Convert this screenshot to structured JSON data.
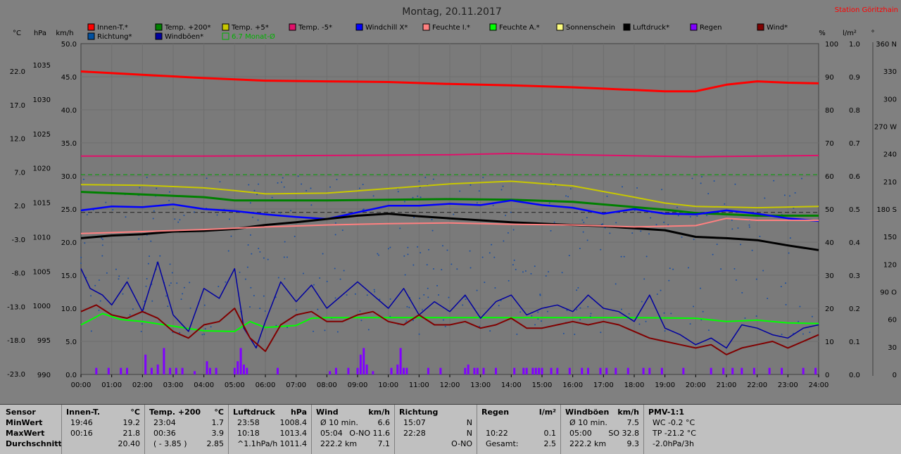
{
  "chart_data": {
    "type": "line",
    "title": "Montag, 20.11.2017",
    "station": "Station Göritzhain",
    "left_axis_units": [
      "°C",
      "hPa",
      "km/h"
    ],
    "right_axis_units": [
      "%",
      "l/m²",
      "°"
    ],
    "axis_celsius": {
      "ticks": [
        "22.0",
        "17.0",
        "12.0",
        "7.0",
        "2.0",
        "-3.0",
        "-8.0",
        "-13.0",
        "-18.0",
        "-23.0"
      ]
    },
    "axis_hpa": {
      "ticks": [
        "1035",
        "1030",
        "1025",
        "1020",
        "1015",
        "1010",
        "1005",
        "1000",
        "995",
        "990"
      ]
    },
    "axis_kmh": {
      "ylim": [
        0,
        50
      ],
      "ticks": [
        "50.0",
        "45.0",
        "40.0",
        "35.0",
        "30.0",
        "25.0",
        "20.0",
        "15.0",
        "10.0",
        "5.0",
        "0.0"
      ]
    },
    "axis_percent": {
      "ticks": [
        "100",
        "90",
        "80",
        "70",
        "60",
        "50",
        "40",
        "30",
        "20",
        "10",
        "0"
      ]
    },
    "axis_rain": {
      "ticks": [
        "1.0",
        "0.9",
        "0.8",
        "0.7",
        "0.6",
        "0.5",
        "0.4",
        "0.3",
        "0.2",
        "0.1",
        "0.0"
      ]
    },
    "axis_degrees": {
      "ticks": [
        "360 N",
        "330",
        "300",
        "270 W",
        "240",
        "210",
        "180 S",
        "150",
        "120",
        "90 O",
        "60",
        "30",
        "0"
      ]
    },
    "x_ticks": [
      "00:00",
      "01:00",
      "02:00",
      "03:00",
      "04:00",
      "05:00",
      "06:00",
      "07:00",
      "08:00",
      "09:00",
      "10:00",
      "11:00",
      "12:00",
      "13:00",
      "14:00",
      "15:00",
      "16:00",
      "17:00",
      "18:00",
      "19:00",
      "20:00",
      "21:00",
      "22:00",
      "23:00",
      "24:00"
    ],
    "legend": [
      {
        "name": "Innen-T.*",
        "color": "#ff0000"
      },
      {
        "name": "Temp. +200*",
        "color": "#008000"
      },
      {
        "name": "Temp. +5*",
        "color": "#c8c800"
      },
      {
        "name": "Temp. -5*",
        "color": "#e0106a"
      },
      {
        "name": "Windchill X*",
        "color": "#0000ff"
      },
      {
        "name": "Feuchte I.*",
        "color": "#ff8080"
      },
      {
        "name": "Feuchte A.*",
        "color": "#00ff00"
      },
      {
        "name": "Sonnenschein",
        "color": "#ffff80"
      },
      {
        "name": "Luftdruck*",
        "color": "#000000"
      },
      {
        "name": "Regen",
        "color": "#8000ff"
      },
      {
        "name": "Wind*",
        "color": "#800000"
      },
      {
        "name": "Richtung*",
        "color": "#0050a0"
      },
      {
        "name": "Windböen*",
        "color": "#0000a0"
      },
      {
        "name": "6.7 Monat-Ø",
        "color": "#00b000"
      }
    ],
    "series": [
      {
        "name": "Innen-T.*",
        "x": [
          0,
          2,
          4,
          6,
          8,
          10,
          12,
          14,
          16,
          18,
          19,
          20,
          21,
          22,
          23,
          24
        ],
        "y": [
          45.8,
          45.3,
          44.8,
          44.4,
          44.3,
          44.2,
          43.9,
          43.7,
          43.4,
          43.0,
          42.8,
          42.8,
          43.8,
          44.3,
          44.1,
          44.0
        ]
      },
      {
        "name": "Temp. -5*",
        "x": [
          0,
          4,
          8,
          12,
          14,
          16,
          20,
          24
        ],
        "y": [
          33.0,
          33.0,
          33.1,
          33.2,
          33.4,
          33.2,
          32.9,
          33.1
        ]
      },
      {
        "name": "Temp. +5*",
        "x": [
          0,
          2,
          4,
          5,
          6,
          8,
          10,
          12,
          14,
          16,
          18,
          19,
          20,
          22,
          24
        ],
        "y": [
          28.7,
          28.6,
          28.2,
          27.8,
          27.3,
          27.4,
          28.1,
          28.8,
          29.2,
          28.5,
          26.8,
          25.9,
          25.4,
          25.2,
          25.4
        ]
      },
      {
        "name": "Temp. +200*",
        "x": [
          0,
          2,
          4,
          5,
          6,
          8,
          10,
          12,
          14,
          16,
          18,
          19,
          20,
          22,
          24
        ],
        "y": [
          27.6,
          27.2,
          26.8,
          26.3,
          26.3,
          26.3,
          26.4,
          26.5,
          26.4,
          26.1,
          25.3,
          24.9,
          24.4,
          24.0,
          24.0
        ]
      },
      {
        "name": "Windchill X*",
        "x": [
          0,
          1,
          2,
          3,
          4,
          5,
          6,
          7,
          8,
          9,
          10,
          11,
          12,
          13,
          14,
          15,
          16,
          17,
          18,
          19,
          20,
          21,
          22,
          23,
          24
        ],
        "y": [
          24.8,
          25.4,
          25.3,
          25.7,
          25.0,
          24.7,
          24.2,
          23.8,
          23.5,
          24.5,
          25.5,
          25.5,
          25.8,
          25.6,
          26.3,
          25.6,
          25.2,
          24.3,
          25.0,
          24.3,
          24.2,
          24.8,
          24.3,
          23.6,
          23.2
        ]
      },
      {
        "name": "Luftdruck*",
        "x": [
          0,
          1,
          2,
          3,
          4,
          5,
          6,
          7,
          8,
          9,
          10,
          11,
          12,
          13,
          14,
          15,
          16,
          17,
          18,
          19,
          20,
          21,
          22,
          23,
          24
        ],
        "y": [
          20.6,
          21.0,
          21.2,
          21.6,
          21.7,
          22.0,
          22.6,
          23.0,
          23.5,
          24.0,
          24.3,
          23.9,
          23.6,
          23.3,
          23.0,
          22.8,
          22.6,
          22.4,
          22.1,
          21.8,
          20.8,
          20.6,
          20.3,
          19.5,
          18.8
        ]
      },
      {
        "name": "Feuchte I.*",
        "x": [
          0,
          2,
          4,
          6,
          8,
          10,
          12,
          14,
          16,
          18,
          20,
          21,
          22,
          24
        ],
        "y": [
          21.3,
          21.6,
          21.9,
          22.3,
          22.6,
          22.8,
          22.9,
          22.7,
          22.6,
          22.3,
          22.5,
          23.6,
          23.3,
          23.3
        ]
      },
      {
        "name": "Feuchte A.*",
        "x": [
          0,
          0.7,
          1.3,
          2,
          3,
          4,
          5,
          5.5,
          6,
          7,
          7.5,
          8,
          10,
          12,
          14,
          16,
          18,
          20,
          21,
          22,
          23,
          24
        ],
        "y": [
          7.5,
          9.2,
          8.3,
          8.0,
          7.3,
          6.6,
          6.5,
          8.0,
          7.1,
          7.4,
          8.5,
          8.6,
          8.6,
          8.6,
          8.6,
          8.6,
          8.6,
          8.5,
          8.0,
          8.2,
          7.8,
          7.7
        ]
      },
      {
        "name": "Windböen*",
        "x": [
          0,
          0.3,
          0.7,
          1,
          1.5,
          2,
          2.5,
          3,
          3.5,
          4,
          4.5,
          5,
          5.3,
          5.7,
          6,
          6.5,
          7,
          7.5,
          8,
          8.5,
          9,
          9.5,
          10,
          10.5,
          11,
          11.5,
          12,
          12.5,
          13,
          13.5,
          14,
          14.5,
          15,
          15.5,
          16,
          16.5,
          17,
          17.5,
          18,
          18.5,
          19,
          19.5,
          20,
          20.5,
          21,
          21.5,
          22,
          22.5,
          23,
          23.5,
          24
        ],
        "y": [
          16,
          13,
          12,
          10.5,
          14,
          9.5,
          17,
          9,
          6.5,
          13,
          11.5,
          16,
          7,
          4,
          8,
          14,
          11,
          13.5,
          10,
          12,
          14,
          12,
          10,
          13,
          9,
          11,
          9.5,
          12,
          8.5,
          11,
          12,
          9,
          10,
          10.5,
          9.5,
          12,
          10,
          9.5,
          8,
          12,
          7,
          6,
          4.5,
          5.5,
          4,
          7.5,
          7,
          6,
          5.5,
          7,
          7.5
        ]
      },
      {
        "name": "Wind*",
        "x": [
          0,
          0.5,
          1,
          1.5,
          2,
          2.5,
          3,
          3.5,
          4,
          4.5,
          5,
          5.5,
          6,
          6.5,
          7,
          7.5,
          8,
          8.5,
          9,
          9.5,
          10,
          10.5,
          11,
          11.5,
          12,
          12.5,
          13,
          13.5,
          14,
          14.5,
          15,
          15.5,
          16,
          16.5,
          17,
          17.5,
          18,
          18.5,
          19,
          19.5,
          20,
          20.5,
          21,
          21.5,
          22,
          22.5,
          23,
          23.5,
          24
        ],
        "y": [
          9.5,
          10.5,
          9,
          8.5,
          9.5,
          8.5,
          6.5,
          5.5,
          7.5,
          8,
          10,
          5.5,
          3.5,
          7.5,
          9,
          9.5,
          8,
          8,
          9,
          9.5,
          8,
          7.5,
          9,
          7.5,
          7.5,
          8,
          7,
          7.5,
          8.5,
          7,
          7,
          7.5,
          8,
          7.5,
          8,
          7.5,
          6.5,
          5.5,
          5,
          4.5,
          4,
          4.5,
          3,
          4,
          4.5,
          5,
          4,
          5,
          6
        ]
      },
      {
        "name": "Regen",
        "x": [
          0.5,
          0.9,
          1.3,
          1.5,
          2.1,
          2.3,
          2.5,
          2.7,
          2.9,
          3.1,
          3.3,
          3.7,
          4.1,
          4.2,
          4.4,
          5.0,
          5.1,
          5.2,
          5.3,
          5.4,
          6.4,
          8.1,
          8.3,
          8.7,
          9.0,
          9.1,
          9.2,
          9.3,
          9.5,
          10.1,
          10.3,
          10.4,
          10.5,
          10.6,
          11.3,
          11.7,
          12.5,
          12.6,
          12.8,
          12.9,
          13.1,
          13.5,
          14.1,
          14.4,
          14.5,
          14.7,
          14.8,
          14.9,
          15.0,
          15.3,
          15.5,
          15.9,
          16.3,
          16.5,
          16.9,
          17.1,
          17.4,
          17.8,
          18.3,
          18.5,
          18.9,
          19.6,
          20.5,
          20.9,
          21.2,
          21.5,
          21.9,
          22.4,
          22.8,
          23.5,
          23.9
        ],
        "y": [
          0.02,
          0.02,
          0.02,
          0.02,
          0.06,
          0.02,
          0.03,
          0.08,
          0.02,
          0.02,
          0.02,
          0.01,
          0.04,
          0.02,
          0.02,
          0.02,
          0.04,
          0.08,
          0.03,
          0.02,
          0.02,
          0.01,
          0.02,
          0.02,
          0.02,
          0.06,
          0.08,
          0.03,
          0.01,
          0.02,
          0.03,
          0.08,
          0.02,
          0.02,
          0.02,
          0.02,
          0.02,
          0.03,
          0.02,
          0.02,
          0.02,
          0.02,
          0.02,
          0.02,
          0.02,
          0.02,
          0.02,
          0.02,
          0.02,
          0.02,
          0.02,
          0.02,
          0.02,
          0.02,
          0.02,
          0.02,
          0.02,
          0.02,
          0.02,
          0.02,
          0.02,
          0.02,
          0.02,
          0.02,
          0.02,
          0.02,
          0.02,
          0.02,
          0.02,
          0.02,
          0.02
        ]
      }
    ],
    "month_avg": 30.2,
    "reference_line": 24.5
  },
  "table": {
    "sensor": {
      "title": "Sensor",
      "rows": [
        "MinWert",
        "MaxWert",
        "Durchschnitt"
      ]
    },
    "innen": {
      "title": "Innen-T.",
      "unit": "°C",
      "rows": [
        [
          "19:46",
          "19.2"
        ],
        [
          "00:16",
          "21.8"
        ],
        [
          "",
          "20.40"
        ]
      ]
    },
    "temp200": {
      "title": "Temp. +200",
      "unit": "°C",
      "rows": [
        [
          "23:04",
          "1.7"
        ],
        [
          "00:36",
          "3.9"
        ],
        [
          "( - 3.85 )",
          "2.85"
        ]
      ]
    },
    "luftdruck": {
      "title": "Luftdruck",
      "unit": "hPa",
      "rows": [
        [
          "23:58",
          "1008.4"
        ],
        [
          "10:18",
          "1013.4"
        ],
        [
          "^1.1hPa/h",
          "1011.4"
        ]
      ]
    },
    "wind": {
      "title": "Wind",
      "unit": "km/h",
      "rows": [
        [
          "Ø 10 min.",
          "6.6"
        ],
        [
          "05:04",
          "O-NO 11.6"
        ],
        [
          "222.2 km",
          "7.1"
        ]
      ]
    },
    "richtung": {
      "title": "Richtung",
      "unit": "",
      "rows": [
        [
          "15:07",
          "N"
        ],
        [
          "22:28",
          "N"
        ],
        [
          "",
          "O-NO"
        ]
      ]
    },
    "regen": {
      "title": "Regen",
      "unit": "l/m²",
      "rows": [
        [
          "",
          ""
        ],
        [
          "10:22",
          "0.1"
        ],
        [
          "Gesamt:",
          "2.5"
        ]
      ]
    },
    "boeen": {
      "title": "Windböen",
      "unit": "km/h",
      "rows": [
        [
          "Ø 10 min.",
          "7.5"
        ],
        [
          "05:00",
          "SO 32.8"
        ],
        [
          "222.2 km",
          "9.3"
        ]
      ]
    },
    "pmv": {
      "title": "PMV-1:1",
      "unit": "",
      "rows": [
        [
          "WC -0.2 °C",
          ""
        ],
        [
          "TP -21.2 °C",
          ""
        ],
        [
          "-2.0hPa/3h",
          ""
        ]
      ]
    }
  }
}
